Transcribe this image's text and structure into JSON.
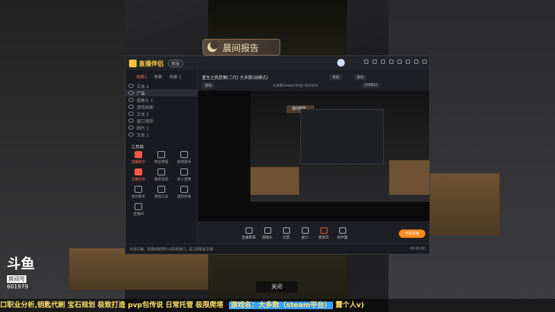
{
  "badge": {
    "text": "晨间报告"
  },
  "app": {
    "logo": "直播伴侣",
    "version": "新版",
    "scene_tabs": [
      "场景1",
      "场景",
      "场景 1"
    ],
    "sources": [
      "文本 2",
      "广告",
      "摄像头 1",
      "游戏画面",
      "文本 1",
      "窗口捕获",
      "图片 1",
      "文本 1"
    ],
    "tools_title": "工具箱",
    "tools": [
      "直播助手",
      "粉丝管理",
      "房管助手",
      "主播任务",
      "抽奖活动",
      "多人连麦",
      "音乐助手",
      "游戏工具",
      "虚拟形象",
      "直播间"
    ],
    "stream_title": "重生之我是懒(二代) 大多数(战模式)",
    "stream_tag": "单机",
    "stream_category": "游戏",
    "game_pill": "游戏",
    "sub_line": "大多数(steam平台)   601979",
    "viewers": "206812",
    "bottom_tools": [
      "直播屏幕",
      "摄像头",
      "全屏",
      "窗口",
      "麦克风",
      "扬声器"
    ],
    "go_live": "开始直播",
    "status_msg": "欢迎主播，如遇到故障可以联系我们，请立即联系主播",
    "status_time": "00:00:00",
    "inner_badge": "晨间报告",
    "inner_close": "关闭"
  },
  "close_button": "关闭",
  "watermark": {
    "brand": "斗鱼",
    "room_label": "房间号",
    "room_number": "601979"
  },
  "ticker": {
    "text": "口职业分析,钥匙代刷 宝石规划 极致打造 pvp包传说 日常托管 极限爬塔",
    "game": "游戏名：大多数（steam平台）",
    "tail": "露个人v)"
  },
  "colors": {
    "accent": "#ff8a1e",
    "brand_yellow": "#f4c83a",
    "ticker_text": "#ffe066"
  }
}
